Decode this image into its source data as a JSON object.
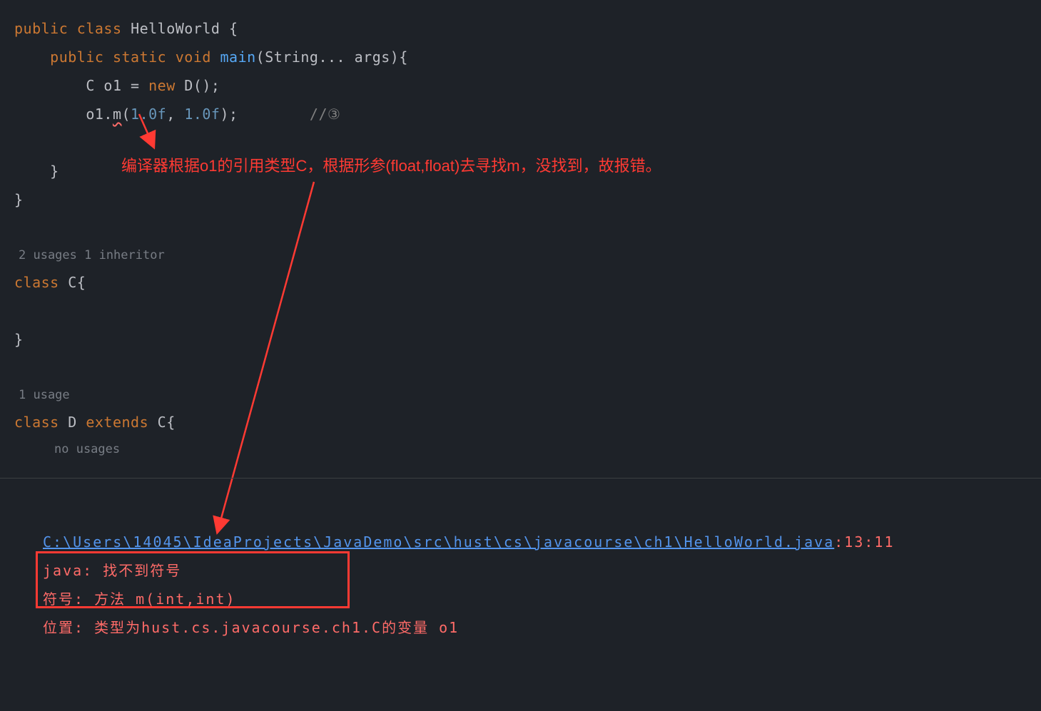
{
  "code": {
    "l1_public": "public",
    "l1_class": "class",
    "l1_name": "HelloWorld",
    "l1_brace": " {",
    "l2_public": "public",
    "l2_static": "static",
    "l2_void": "void",
    "l2_main": "main",
    "l2_params": "(String... args){",
    "l3_type": "C o1 = ",
    "l3_new": "new",
    "l3_rest": " D();",
    "l4_obj": "o1.",
    "l4_method": "m",
    "l4_args_paren": "(",
    "l4_n1": "1.0f",
    "l4_comma": ", ",
    "l4_n2": "1.0f",
    "l4_close": ");",
    "l4_spaces": "        ",
    "l4_comment": "//③",
    "l5_brace": "}",
    "l6_brace": "}",
    "usages1": "2 usages   1 inheritor",
    "l7_class": "class",
    "l7_name": " C{",
    "l8_brace": "}",
    "usages2": "1 usage",
    "l9_class": "class",
    "l9_name": " D ",
    "l9_extends": "extends",
    "l9_rest": " C{",
    "usages3": "no usages"
  },
  "annotation": "编译器根据o1的引用类型C，根据形参(float,float)去寻找m，没找到，故报错。",
  "console": {
    "file_path": "C:\\Users\\14045\\IdeaProjects\\JavaDemo\\src\\hust\\cs\\javacourse\\ch1\\HelloWorld.java",
    "line_col": ":13:11",
    "err_line1_a": "java:",
    "err_line1_b": " 找不到符号",
    "err_line2_a": "  符号:   方法 ",
    "err_line2_b": "m(int,int)",
    "err_line3": "  位置: 类型为hust.cs.javacourse.ch1.C的变量 o1"
  }
}
